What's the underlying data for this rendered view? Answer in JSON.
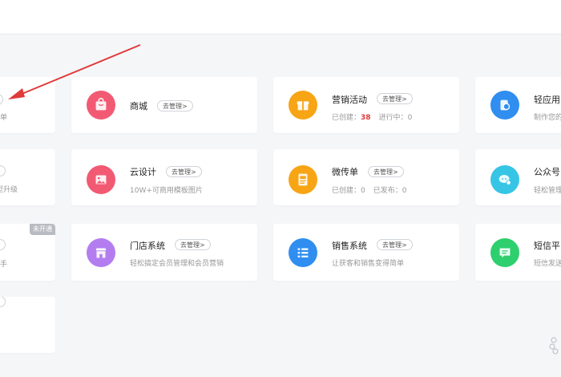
{
  "cards": {
    "left_col": {
      "r1": {
        "partial_desc": "单"
      },
      "r2": {
        "partial_desc": "转型升级"
      },
      "r3": {
        "badge": "未开通",
        "partial_desc": "手"
      }
    },
    "shop": {
      "title": "商城",
      "manage": "去管理>"
    },
    "marketing": {
      "title": "营销活动",
      "manage": "去管理>",
      "created_label": "已创建：",
      "created_value": "38",
      "ongoing_label": "进行中：",
      "ongoing_value": "0"
    },
    "light_app": {
      "title": "轻应用",
      "desc": "制作您的"
    },
    "cloud_design": {
      "title": "云设计",
      "manage": "去管理>",
      "desc": "10W+可商用模板图片"
    },
    "micro_flyer": {
      "title": "微传单",
      "manage": "去管理>",
      "created_label": "已创建：",
      "created_value": "0",
      "published_label": "已发布：",
      "published_value": "0"
    },
    "official_account": {
      "title": "公众号",
      "desc": "轻松管理"
    },
    "store_system": {
      "title": "门店系统",
      "manage": "去管理>",
      "desc": "轻松搞定会员管理和会员营销"
    },
    "sales_system": {
      "title": "销售系统",
      "manage": "去管理>",
      "desc": "让获客和销售变得简单"
    },
    "sms": {
      "title": "短信平",
      "desc": "短信发送"
    }
  },
  "colors": {
    "shop_icon": "#f25a73",
    "marketing_icon": "#f7a515",
    "light_app_icon": "#2f8ef0",
    "cloud_design_icon": "#f25a73",
    "micro_flyer_icon": "#f7a515",
    "official_account_icon": "#37c5e6",
    "store_system_icon": "#b37df0",
    "sales_system_icon": "#2f8ef0",
    "sms_icon": "#2ecf6e",
    "arrow": "#e03a3a"
  }
}
